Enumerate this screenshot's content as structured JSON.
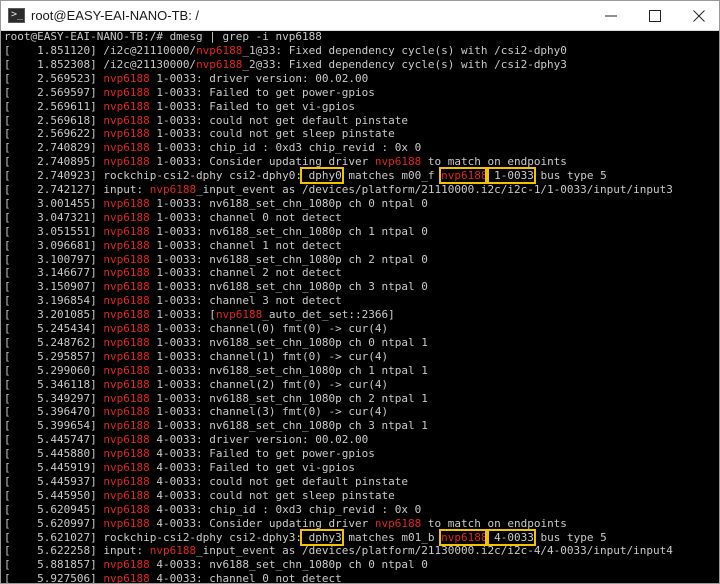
{
  "window": {
    "title": "root@EASY-EAI-NANO-TB: /"
  },
  "colors": {
    "background": "#000000",
    "text": "#c9c9c9",
    "highlight_keyword": "#e22424",
    "annotation_box": "#f2c200"
  },
  "terminal": {
    "prompt": "root@EASY-EAI-NANO-TB:/# dmesg | grep -i nvp6188",
    "lines": [
      {
        "ts": "[    1.851120] ",
        "pre": "/i2c@21110000/",
        "kw": "nvp6188",
        "post": "_1@33: Fixed dependency cycle(s) with /csi2-dphy0"
      },
      {
        "ts": "[    1.852308] ",
        "pre": "/i2c@21130000/",
        "kw": "nvp6188",
        "post": "_2@33: Fixed dependency cycle(s) with /csi2-dphy3"
      },
      {
        "ts": "[    2.569523] ",
        "pre": "",
        "kw": "nvp6188",
        "post": " 1-0033: driver version: 00.02.00"
      },
      {
        "ts": "[    2.569597] ",
        "pre": "",
        "kw": "nvp6188",
        "post": " 1-0033: Failed to get power-gpios"
      },
      {
        "ts": "[    2.569611] ",
        "pre": "",
        "kw": "nvp6188",
        "post": " 1-0033: Failed to get vi-gpios"
      },
      {
        "ts": "[    2.569618] ",
        "pre": "",
        "kw": "nvp6188",
        "post": " 1-0033: could not get default pinstate"
      },
      {
        "ts": "[    2.569622] ",
        "pre": "",
        "kw": "nvp6188",
        "post": " 1-0033: could not get sleep pinstate"
      },
      {
        "ts": "[    2.740829] ",
        "pre": "",
        "kw": "nvp6188",
        "post": " 1-0033: chip_id : 0xd3 chip_revid : 0x 0"
      },
      {
        "ts": "[    2.740895] ",
        "pre": "",
        "kw": "nvp6188",
        "post": " 1-0033: Consider updating driver ",
        "kw2": "nvp6188",
        "post2": " to match on endpoints"
      },
      {
        "ts": "[    2.740923] ",
        "special": "dphy0"
      },
      {
        "ts": "[    2.742127] ",
        "pre": "input: ",
        "kw": "nvp6188",
        "post": "_input_event as /devices/platform/21110000.i2c/i2c-1/1-0033/input/input3"
      },
      {
        "ts": "[    3.001455] ",
        "pre": "",
        "kw": "nvp6188",
        "post": " 1-0033: nv6188_set_chn_1080p ch 0 ntpal 0"
      },
      {
        "ts": "[    3.047321] ",
        "pre": "",
        "kw": "nvp6188",
        "post": " 1-0033: channel 0 not detect"
      },
      {
        "ts": "[    3.051551] ",
        "pre": "",
        "kw": "nvp6188",
        "post": " 1-0033: nv6188_set_chn_1080p ch 1 ntpal 0"
      },
      {
        "ts": "[    3.096681] ",
        "pre": "",
        "kw": "nvp6188",
        "post": " 1-0033: channel 1 not detect"
      },
      {
        "ts": "[    3.100797] ",
        "pre": "",
        "kw": "nvp6188",
        "post": " 1-0033: nv6188_set_chn_1080p ch 2 ntpal 0"
      },
      {
        "ts": "[    3.146677] ",
        "pre": "",
        "kw": "nvp6188",
        "post": " 1-0033: channel 2 not detect"
      },
      {
        "ts": "[    3.150907] ",
        "pre": "",
        "kw": "nvp6188",
        "post": " 1-0033: nv6188_set_chn_1080p ch 3 ntpal 0"
      },
      {
        "ts": "[    3.196854] ",
        "pre": "",
        "kw": "nvp6188",
        "post": " 1-0033: channel 3 not detect"
      },
      {
        "ts": "[    3.201085] ",
        "pre": "",
        "kw": "nvp6188",
        "post": " 1-0033: [",
        "kw2": "nvp6188",
        "post2": "_auto_det_set::2366]"
      },
      {
        "ts": "[    5.245434] ",
        "pre": "",
        "kw": "nvp6188",
        "post": " 1-0033: channel(0) fmt(0) -> cur(4)"
      },
      {
        "ts": "[    5.248762] ",
        "pre": "",
        "kw": "nvp6188",
        "post": " 1-0033: nv6188_set_chn_1080p ch 0 ntpal 1"
      },
      {
        "ts": "[    5.295857] ",
        "pre": "",
        "kw": "nvp6188",
        "post": " 1-0033: channel(1) fmt(0) -> cur(4)"
      },
      {
        "ts": "[    5.299060] ",
        "pre": "",
        "kw": "nvp6188",
        "post": " 1-0033: nv6188_set_chn_1080p ch 1 ntpal 1"
      },
      {
        "ts": "[    5.346118] ",
        "pre": "",
        "kw": "nvp6188",
        "post": " 1-0033: channel(2) fmt(0) -> cur(4)"
      },
      {
        "ts": "[    5.349297] ",
        "pre": "",
        "kw": "nvp6188",
        "post": " 1-0033: nv6188_set_chn_1080p ch 2 ntpal 1"
      },
      {
        "ts": "[    5.396470] ",
        "pre": "",
        "kw": "nvp6188",
        "post": " 1-0033: channel(3) fmt(0) -> cur(4)"
      },
      {
        "ts": "[    5.399654] ",
        "pre": "",
        "kw": "nvp6188",
        "post": " 1-0033: nv6188_set_chn_1080p ch 3 ntpal 1"
      },
      {
        "ts": "[    5.445747] ",
        "pre": "",
        "kw": "nvp6188",
        "post": " 4-0033: driver version: 00.02.00"
      },
      {
        "ts": "[    5.445880] ",
        "pre": "",
        "kw": "nvp6188",
        "post": " 4-0033: Failed to get power-gpios"
      },
      {
        "ts": "[    5.445919] ",
        "pre": "",
        "kw": "nvp6188",
        "post": " 4-0033: Failed to get vi-gpios"
      },
      {
        "ts": "[    5.445937] ",
        "pre": "",
        "kw": "nvp6188",
        "post": " 4-0033: could not get default pinstate"
      },
      {
        "ts": "[    5.445950] ",
        "pre": "",
        "kw": "nvp6188",
        "post": " 4-0033: could not get sleep pinstate"
      },
      {
        "ts": "[    5.620945] ",
        "pre": "",
        "kw": "nvp6188",
        "post": " 4-0033: chip_id : 0xd3 chip_revid : 0x 0"
      },
      {
        "ts": "[    5.620997] ",
        "pre": "",
        "kw": "nvp6188",
        "post": " 4-0033: Consider updating driver ",
        "kw2": "nvp6188",
        "post2": " to match on endpoints"
      },
      {
        "ts": "[    5.621027] ",
        "special": "dphy3"
      },
      {
        "ts": "[    5.622258] ",
        "pre": "input: ",
        "kw": "nvp6188",
        "post": "_input_event as /devices/platform/21130000.i2c/i2c-4/4-0033/input/input4"
      },
      {
        "ts": "[    5.881857] ",
        "pre": "",
        "kw": "nvp6188",
        "post": " 4-0033: nv6188_set_chn_1080p ch 0 ntpal 0"
      },
      {
        "ts": "[    5.927506] ",
        "pre": "",
        "kw": "nvp6188",
        "post": " 4-0033: channel 0 not detect"
      }
    ],
    "special_lines": {
      "dphy0": {
        "a": "rockchip-csi2-dphy csi2-dphy0:",
        "box1": " dphy0",
        "b": " matches m00_f ",
        "box2": "nvp6188",
        "box3": " 1-0033",
        "c": " bus type 5"
      },
      "dphy3": {
        "a": "rockchip-csi2-dphy csi2-dphy3:",
        "box1": " dphy3",
        "b": " matches m01_b ",
        "box2": "nvp6188",
        "box3": " 4-0033",
        "c": " bus type 5"
      }
    }
  }
}
